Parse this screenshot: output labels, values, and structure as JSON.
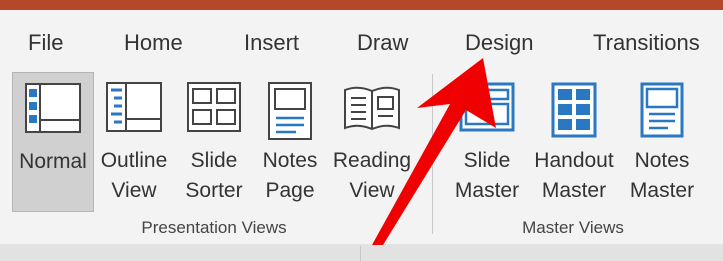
{
  "tabs": [
    "File",
    "Home",
    "Insert",
    "Draw",
    "Design",
    "Transitions"
  ],
  "presentation_views": {
    "group_label": "Presentation Views",
    "buttons": [
      {
        "label": "Normal",
        "icon": "normal-view-icon",
        "active": true
      },
      {
        "label": "Outline\nView",
        "icon": "outline-view-icon"
      },
      {
        "label": "Slide\nSorter",
        "icon": "slide-sorter-icon"
      },
      {
        "label": "Notes\nPage",
        "icon": "notes-page-icon"
      },
      {
        "label": "Reading\nView",
        "icon": "reading-view-icon"
      }
    ]
  },
  "master_views": {
    "group_label": "Master Views",
    "buttons": [
      {
        "label": "Slide\nMaster",
        "icon": "slide-master-icon"
      },
      {
        "label": "Handout\nMaster",
        "icon": "handout-master-icon"
      },
      {
        "label": "Notes\nMaster",
        "icon": "notes-master-icon"
      }
    ]
  },
  "colors": {
    "title_bar": "#b7472a",
    "icon_blue": "#2b78c2",
    "active_button": "#d0d0d0",
    "annotation_arrow": "#f00000"
  }
}
